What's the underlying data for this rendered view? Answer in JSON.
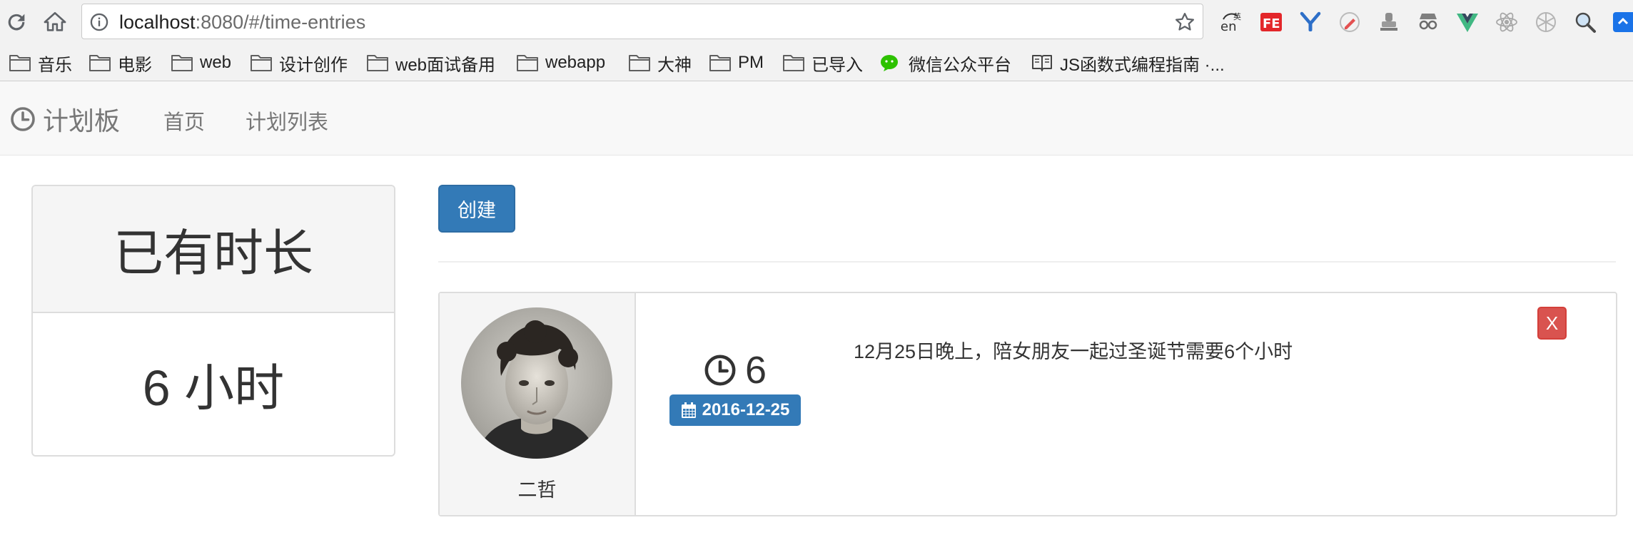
{
  "browser": {
    "url_host": "localhost",
    "url_rest": ":8080/#/time-entries",
    "bookmarks": [
      {
        "label": "音乐",
        "icon": "folder-icon"
      },
      {
        "label": "电影",
        "icon": "folder-icon"
      },
      {
        "label": "web",
        "icon": "folder-icon"
      },
      {
        "label": "设计创作",
        "icon": "folder-icon"
      },
      {
        "label": "web面试备用",
        "icon": "folder-icon"
      },
      {
        "label": "webapp",
        "icon": "folder-icon"
      },
      {
        "label": "大神",
        "icon": "folder-icon"
      },
      {
        "label": "PM",
        "icon": "folder-icon"
      },
      {
        "label": "已导入",
        "icon": "folder-icon"
      },
      {
        "label": "微信公众平台",
        "icon": "wechat-icon"
      },
      {
        "label": "JS函数式编程指南 ·...",
        "icon": "book-icon"
      }
    ],
    "extensions": [
      "translate-icon",
      "fe-icon",
      "y-icon",
      "pen-icon",
      "stamp-icon",
      "spy-icon",
      "vue-icon",
      "react-icon",
      "aperture-icon",
      "magnifier-icon",
      "blue-extension-icon"
    ]
  },
  "navbar": {
    "brand": "计划板",
    "links": [
      "首页",
      "计划列表"
    ]
  },
  "summary": {
    "title": "已有时长",
    "value": "6 小时"
  },
  "actions": {
    "create_label": "创建"
  },
  "entry": {
    "user_name": "二哲",
    "hours": "6",
    "date": "2016-12-25",
    "comment": "12月25日晚上，陪女朋友一起过圣诞节需要6个小时",
    "delete_label": "X"
  },
  "colors": {
    "primary": "#337ab7",
    "danger": "#d9534f",
    "navbar_bg": "#f8f8f8"
  }
}
